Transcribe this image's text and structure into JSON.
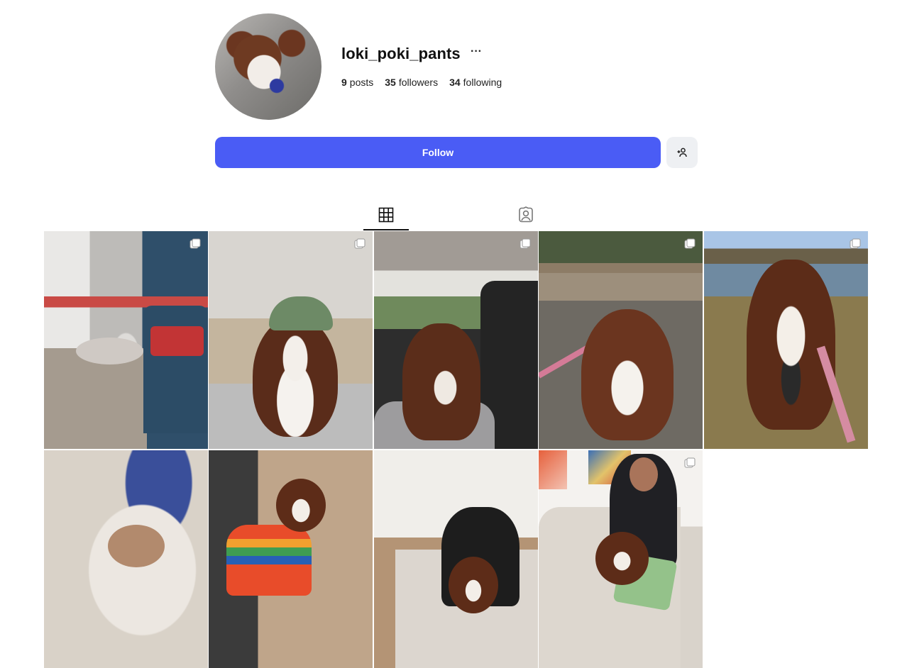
{
  "profile": {
    "username": "loki_poki_pants",
    "more_label": "···",
    "stats": {
      "posts_count": "9",
      "posts_label": "posts",
      "followers_count": "35",
      "followers_label": "followers",
      "following_count": "34",
      "following_label": "following"
    }
  },
  "actions": {
    "follow_label": "Follow",
    "follow_color": "#4a5cf5",
    "add_user_icon": "add-user-icon"
  },
  "tabs": [
    {
      "icon": "grid-icon",
      "active": true
    },
    {
      "icon": "tagged-icon",
      "active": false
    }
  ],
  "posts": [
    {
      "subject": "dog on bench bed beside blue chair",
      "multi": true
    },
    {
      "subject": "dog wearing green bucket hat",
      "multi": true
    },
    {
      "subject": "dog in car back seat",
      "multi": true
    },
    {
      "subject": "dog on leash by wooden fence",
      "multi": true
    },
    {
      "subject": "dog on grass by lake",
      "multi": true
    },
    {
      "subject": "dog sleeping upside down",
      "multi": false
    },
    {
      "subject": "dog in rainbow sweater",
      "multi": false
    },
    {
      "subject": "person with dog on rug",
      "multi": false
    },
    {
      "subject": "man on sofa with dog",
      "multi": true
    }
  ]
}
